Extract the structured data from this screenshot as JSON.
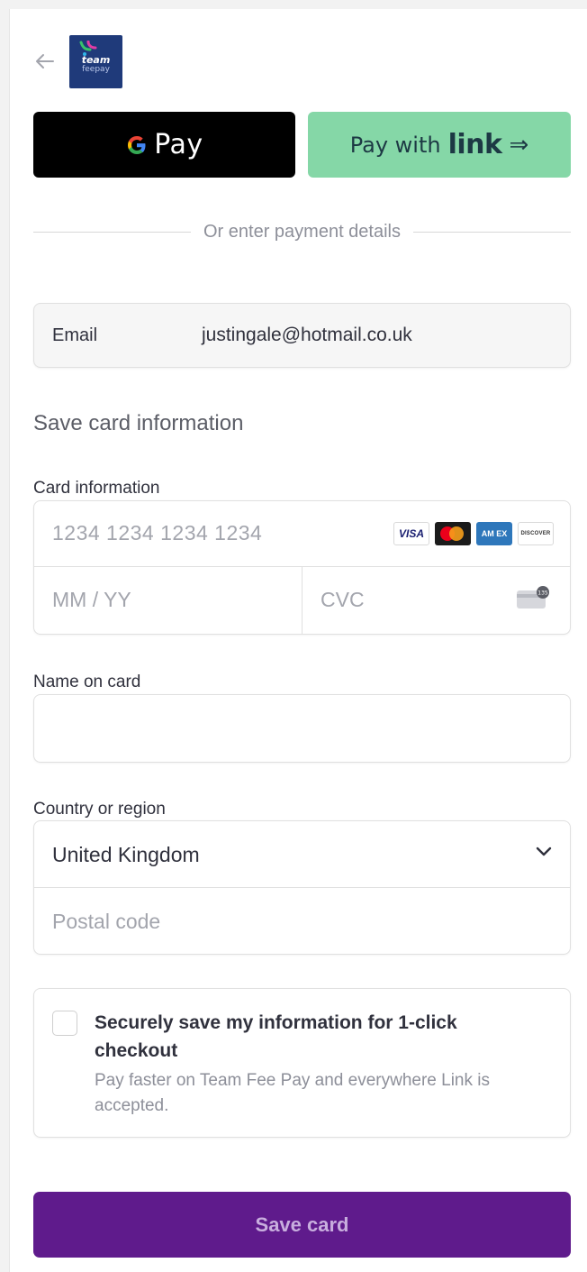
{
  "header": {
    "back_icon": "arrow-left-icon",
    "logo_text_top": "team",
    "logo_text_bottom": "feepay"
  },
  "wallet": {
    "google_pay_label": "Pay",
    "link_prefix": "Pay with",
    "link_brand": "link",
    "link_arrow": "⇒"
  },
  "divider_text": "Or enter payment details",
  "email": {
    "label": "Email",
    "value": "justingale@hotmail.co.uk"
  },
  "section_title": "Save card information",
  "card": {
    "label": "Card information",
    "number_placeholder": "1234 1234 1234 1234",
    "expiry_placeholder": "MM / YY",
    "cvc_placeholder": "CVC",
    "brands": {
      "visa": "VISA",
      "amex": "AM EX",
      "discover": "DISCOVER"
    },
    "cvc_hint": "135"
  },
  "name": {
    "label": "Name on card",
    "value": ""
  },
  "country": {
    "label": "Country or region",
    "selected": "United Kingdom",
    "postal_placeholder": "Postal code"
  },
  "save_info": {
    "title": "Securely save my information for 1-click checkout",
    "subtitle": "Pay faster on Team Fee Pay and everywhere Link is accepted.",
    "checked": false
  },
  "submit_label": "Save card",
  "colors": {
    "link_green": "#85d7a7",
    "primary_purple": "#5f1b8c",
    "google_pay_black": "#000000"
  }
}
